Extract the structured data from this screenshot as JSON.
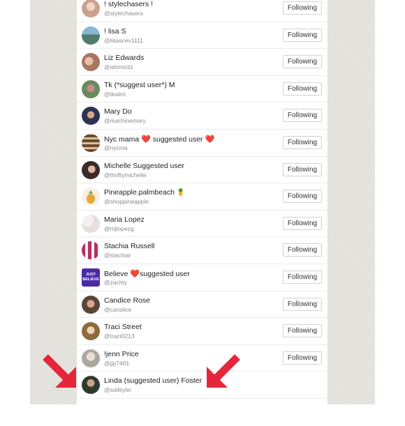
{
  "users": [
    {
      "name": "! stylechasers !",
      "handle": "@stylechasers",
      "button": "Following",
      "avatar": "#c9a28e"
    },
    {
      "name": "! lisa S",
      "handle": "@lisascev1111",
      "button": "Following",
      "avatar": "#4f7d6a"
    },
    {
      "name": "Liz Edwards",
      "handle": "@atomicliz",
      "button": "Following",
      "avatar": "#a77660"
    },
    {
      "name": "Tk (*suggest user*) M",
      "handle": "@tkalim",
      "button": "Following",
      "avatar": "#6b8a5c"
    },
    {
      "name": "Mary Do",
      "handle": "@machinemary",
      "button": "Following",
      "avatar": "#2d3350"
    },
    {
      "name": "Nyc mama",
      "suffix": "suggested user",
      "handle": "@nycma",
      "button": "Following",
      "avatar": "#6d4a2e"
    },
    {
      "name": "Michelle Suggested user",
      "handle": "@thriftymichelle",
      "button": "Following",
      "avatar": "#3b2a2a"
    },
    {
      "name": "Pineapple.palmbeach",
      "handle": "@shoppineapple",
      "button": "Following",
      "avatar": "#e9d9b8"
    },
    {
      "name": "Maria Lopez",
      "handle": "@mjlopezg",
      "button": "Following",
      "avatar": "#e8dede"
    },
    {
      "name": "Stachia Russell",
      "handle": "@stachiar",
      "button": "Following",
      "avatar": "#b53060"
    },
    {
      "name": "Believe",
      "suffix": "suggested user",
      "handle": "@zachty",
      "button": "Following",
      "avatar": "#4b2aa8",
      "avatar_text": "JUST BELIEVE"
    },
    {
      "name": "Candice Rose",
      "handle": "@canslice",
      "button": "Following",
      "avatar": "#5a4638"
    },
    {
      "name": "Traci Street",
      "handle": "@traci0213",
      "button": "Following",
      "avatar": "#8b6b3f"
    },
    {
      "name": "!jenn Price",
      "handle": "@jjp7401",
      "button": "Following",
      "avatar": "#b0a6a0"
    },
    {
      "name": "Linda (suggested user) Foster",
      "handle": "@salleylin",
      "button": "",
      "avatar": "#2f3a2f"
    }
  ],
  "colors": {
    "arrow": "#e5263a",
    "heart": "#e0172b"
  }
}
